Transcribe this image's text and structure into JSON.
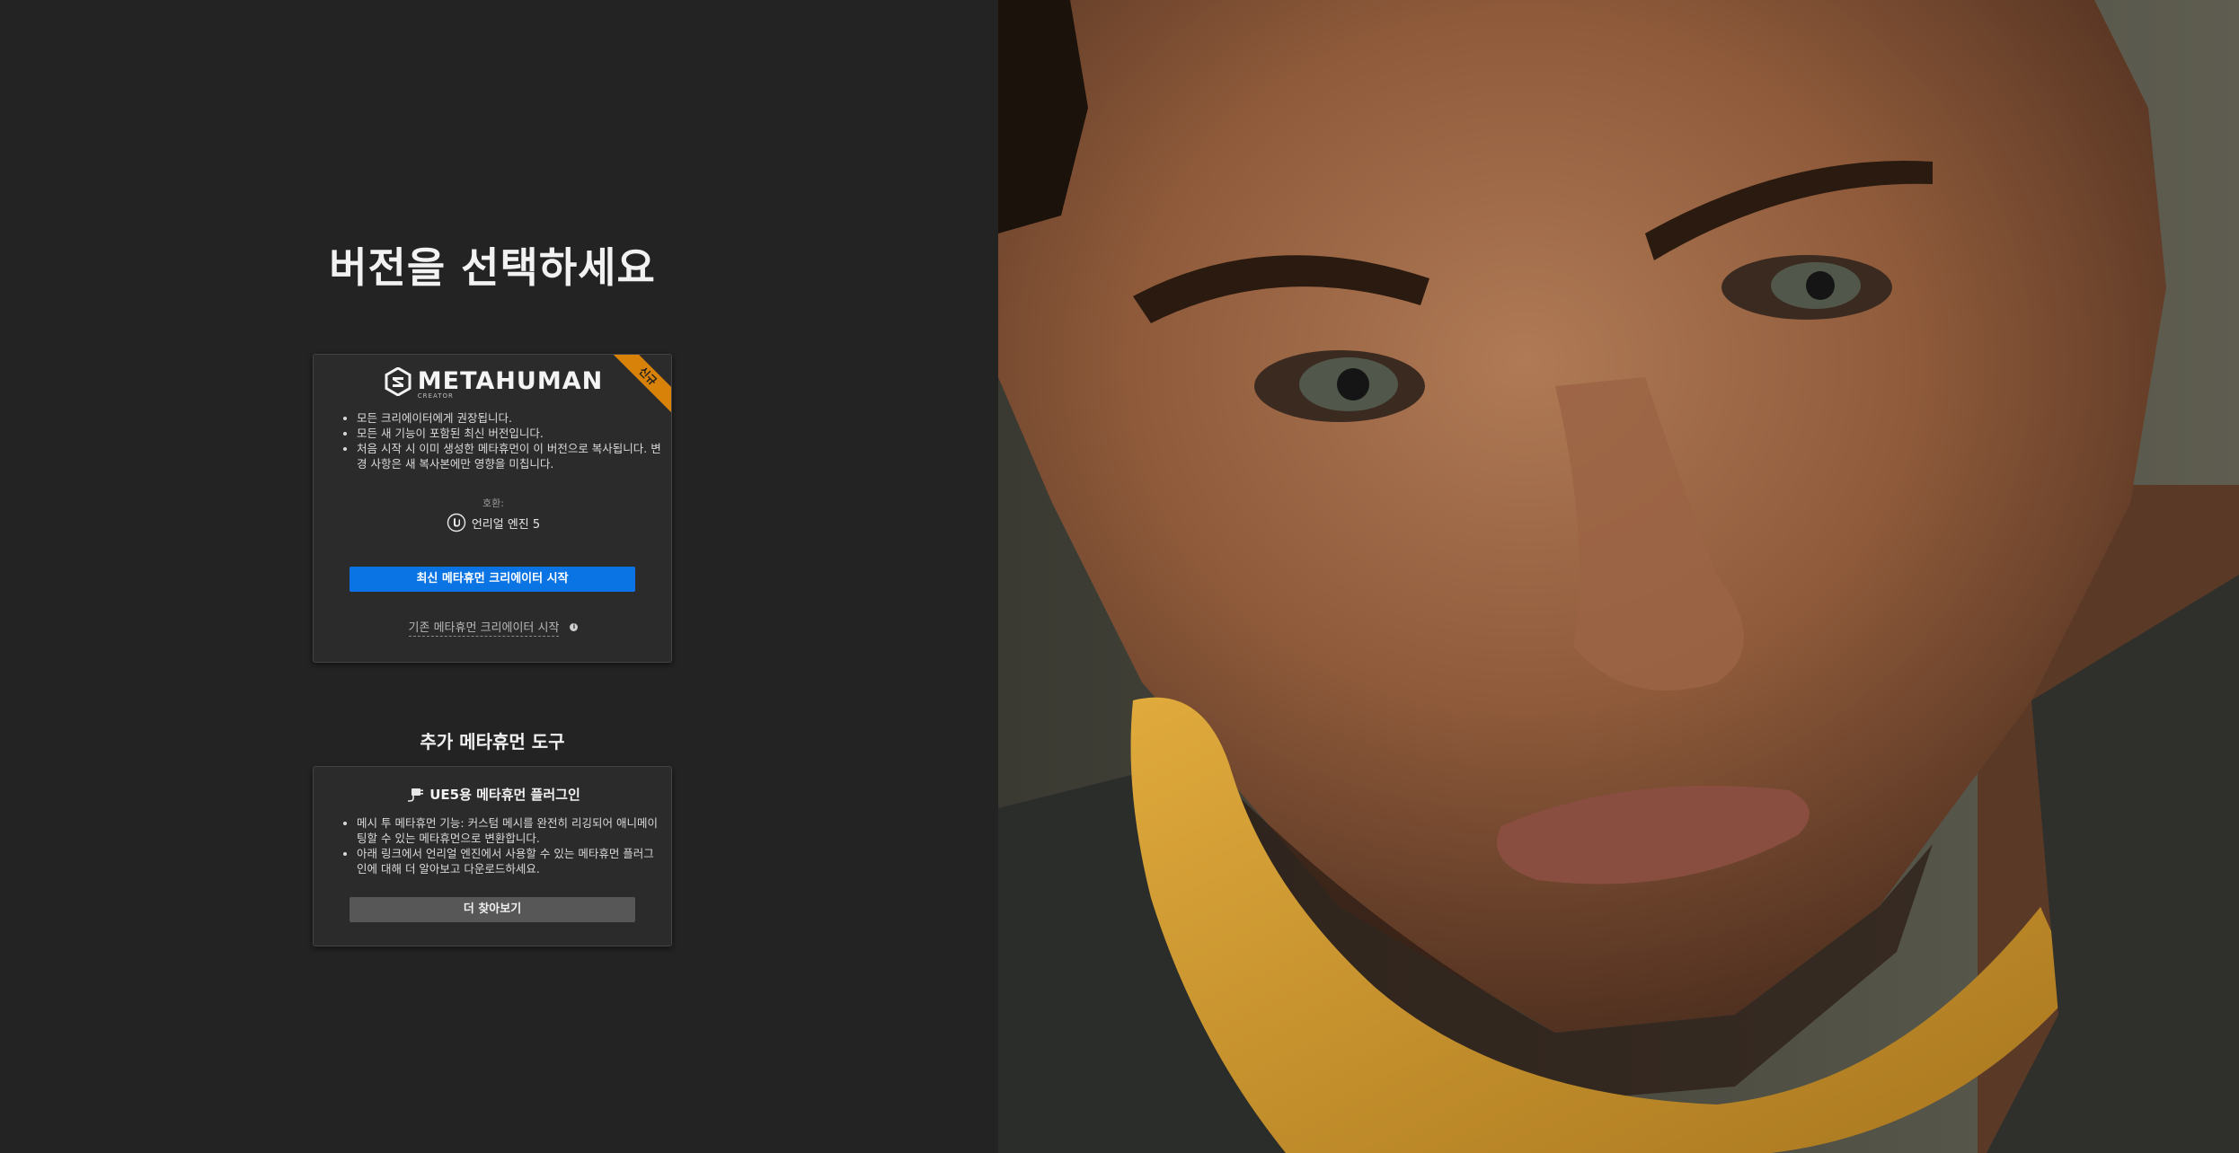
{
  "page_title": "버전을 선택하세요",
  "main_card": {
    "logo_text": "METAHUMAN",
    "logo_subtext": "CREATOR",
    "logo_icon": "metahuman-logo-icon",
    "badge": "신규",
    "badge_color": "#d8820a",
    "bullets": [
      "모든 크리에이터에게 권장됩니다.",
      "모든 새 기능이 포함된 최신 버전입니다.",
      "처음 시작 시 이미 생성한 메타휴먼이 이 버전으로 복사됩니다. 변경 사항은 새 복사본에만 영향을 미칩니다."
    ],
    "compat_label": "호환:",
    "engine_icon": "unreal-engine-icon",
    "engine_name": "언리얼 엔진 5",
    "primary_button": "최신 메타휴먼 크리에이터 시작",
    "primary_color": "#0a74e4",
    "legacy_link": "기존 메타휴먼 크리에이터 시작",
    "legacy_info_icon": "info-icon"
  },
  "tools_section": {
    "title": "추가 메타휴먼 도구"
  },
  "plugin_card": {
    "icon": "plugin-plug-icon",
    "title": "UE5용 메타휴먼 플러그인",
    "bullets": [
      "메시 투 메타휴먼 기능: 커스텀 메시를 완전히 리깅되어 애니메이팅할 수 있는 메타휴먼으로 변환합니다.",
      "아래 링크에서 언리얼 엔진에서 사용할 수 있는 메타휴먼 플러그인에 대해 더 알아보고 다운로드하세요."
    ],
    "button": "더 찾아보기"
  },
  "hero": {
    "image": "metahuman-portrait-image"
  }
}
